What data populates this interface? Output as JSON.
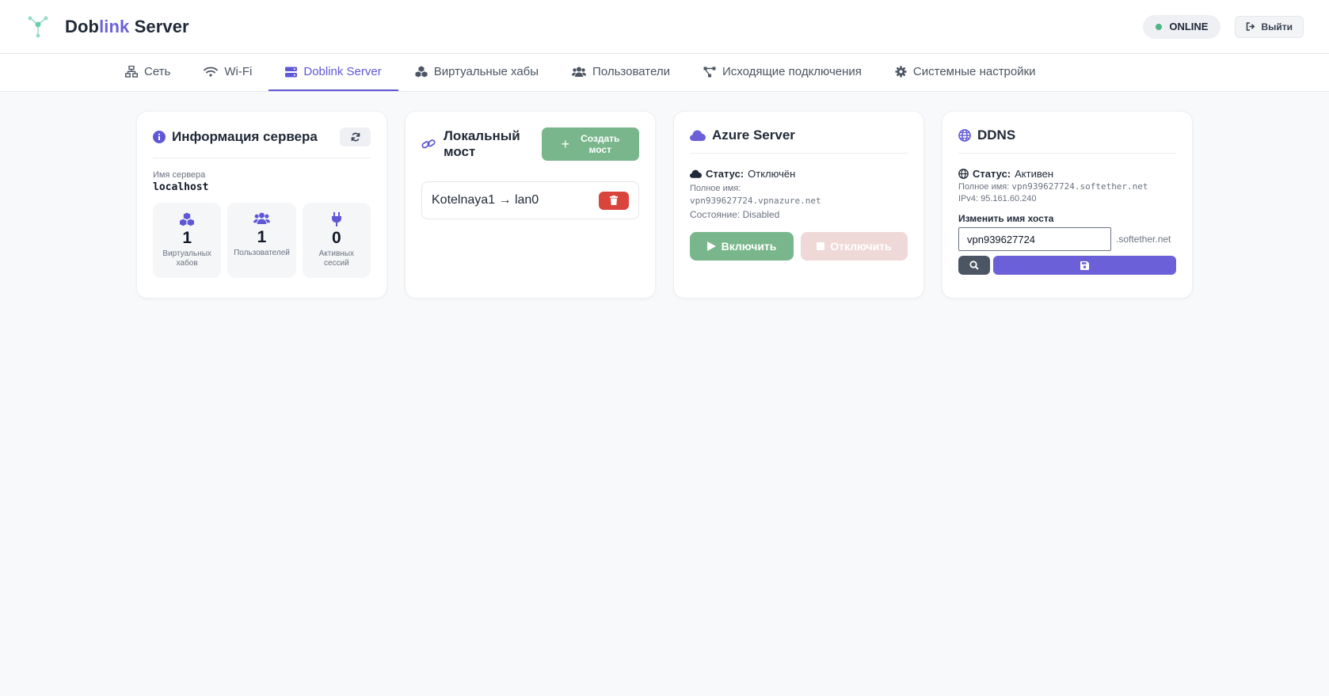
{
  "header": {
    "brand_part1": "Dob",
    "brand_part2": "link",
    "brand_part3": " Server",
    "status": "ONLINE",
    "logout_label": "Выйти"
  },
  "tabs": [
    {
      "label": "Сеть",
      "icon": "network-icon"
    },
    {
      "label": "Wi-Fi",
      "icon": "wifi-icon"
    },
    {
      "label": "Doblink Server",
      "icon": "server-icon",
      "active": true
    },
    {
      "label": "Виртуальные хабы",
      "icon": "cubes-icon"
    },
    {
      "label": "Пользователи",
      "icon": "users-icon"
    },
    {
      "label": "Исходящие подключения",
      "icon": "outgoing-icon"
    },
    {
      "label": "Системные настройки",
      "icon": "gear-icon"
    }
  ],
  "server_info": {
    "title": "Информация сервера",
    "name_label": "Имя сервера",
    "name_value": "localhost",
    "stats": [
      {
        "value": "1",
        "label": "Виртуальных хабов"
      },
      {
        "value": "1",
        "label": "Пользователей"
      },
      {
        "value": "0",
        "label": "Активных сессий"
      }
    ]
  },
  "bridge": {
    "title_line1": "Локальный",
    "title_line2": "мост",
    "create_line1": "Создать",
    "create_line2": "мост",
    "items": [
      {
        "name": "Kotelnaya1 → lan0"
      }
    ]
  },
  "azure": {
    "title": "Azure Server",
    "status_label": "Статус:",
    "status_value": "Отключён",
    "fullname_label": "Полное имя:",
    "fullname_value": "vpn939627724.vpnazure.net",
    "state_label": "Состояние:",
    "state_value": "Disabled",
    "enable_label": "Включить",
    "disable_label": "Отключить"
  },
  "ddns": {
    "title": "DDNS",
    "status_label": "Статус:",
    "status_value": "Активен",
    "fullname_label": "Полное имя:",
    "fullname_value": "vpn939627724.softether.net",
    "ipv4_label": "IPv4:",
    "ipv4_value": "95.161.60.240",
    "change_label": "Изменить имя хоста",
    "host_value": "vpn939627724",
    "host_suffix": ".softether.net"
  },
  "colors": {
    "accent": "#5f58d6",
    "success": "#79b68c",
    "danger": "#d9453d",
    "online_dot": "#4fb583"
  }
}
